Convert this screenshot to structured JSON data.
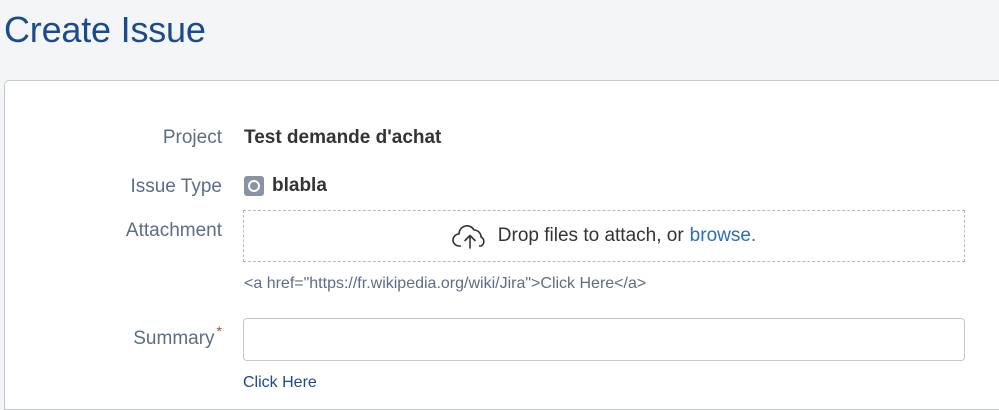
{
  "page": {
    "title": "Create Issue"
  },
  "form": {
    "project": {
      "label": "Project",
      "value": "Test demande d'achat"
    },
    "issue_type": {
      "label": "Issue Type",
      "value": "blabla",
      "icon": "issue-type-icon"
    },
    "attachment": {
      "label": "Attachment",
      "drop_text": "Drop files to attach, or",
      "browse_label": "browse.",
      "description": "<a href=\"https://fr.wikipedia.org/wiki/Jira\">Click Here</a>"
    },
    "summary": {
      "label": "Summary",
      "required_marker": "*",
      "value": "",
      "link_label": "Click Here"
    }
  },
  "colors": {
    "title": "#1a4b8c",
    "label": "#5e6c84",
    "link": "#2a6ebb",
    "required": "#de350b"
  }
}
